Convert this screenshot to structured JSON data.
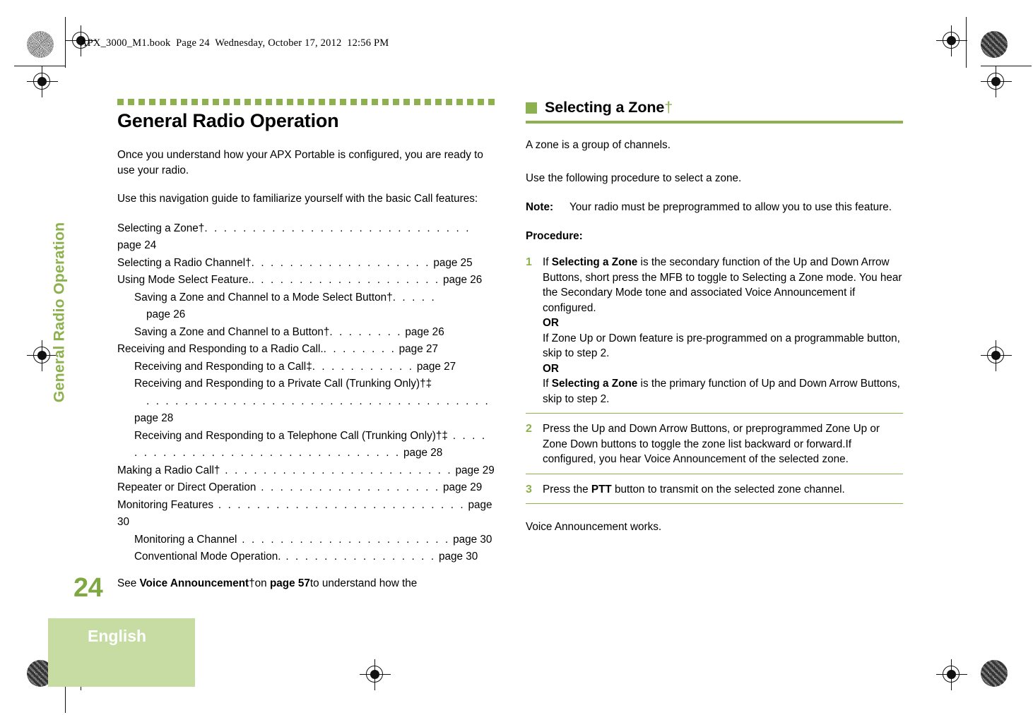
{
  "doc": {
    "header": "APX_3000_M1.book  Page 24  Wednesday, October 17, 2012  12:56 PM",
    "chapter_tab": "General Radio Operation",
    "page_number": "24",
    "language_tab": "English",
    "accent_color": "#8DB14E",
    "tab_color": "#C6DCA2"
  },
  "left_column": {
    "title": "General Radio Operation",
    "intro_1": "Once you understand how your APX Portable is configured, you are ready to use your radio.",
    "intro_2": "Use this navigation guide to familiarize yourself with the basic Call features:",
    "toc": [
      {
        "label": "Selecting a Zone†",
        "leader": ". . . . . . . . . . . . . . . . . . . . . . . . . . . .",
        "page": "page 24",
        "indent": 0
      },
      {
        "label": "Selecting a Radio Channel†",
        "leader": ". . . . . . . . . . . . . . . . . . .",
        "page": "page 25",
        "indent": 0
      },
      {
        "label": "Using Mode Select Feature.",
        "leader": ". . . . . . . . . . . . . . . . . . . .",
        "page": "page 26",
        "indent": 0
      },
      {
        "label": "Saving a Zone and Channel to a Mode Select Button†",
        "leader": ". . . . .",
        "page": "page 26",
        "indent": 1,
        "page_on_new_line": true
      },
      {
        "label": "Saving a Zone and Channel to a Button†",
        "leader": ". . . . . . . .",
        "page": "page 26",
        "indent": 1
      },
      {
        "label": "Receiving and Responding to a Radio Call.",
        "leader": ". . . . . . . .",
        "page": "page 27",
        "indent": 0
      },
      {
        "label": "Receiving and Responding to a Call‡",
        "leader": ". . . . . . . . . . .",
        "page": "page 27",
        "indent": 1
      },
      {
        "label": "Receiving and Responding to a Private Call (Trunking Only)†‡",
        "leader": ". . . . . . . . . . . . . . . . . . . . . . . . . . . . . . . . . . . .",
        "page": "page 28",
        "indent": 1,
        "leader_on_new_line": true
      },
      {
        "label": "Receiving and Responding to a Telephone Call (Trunking Only)†‡",
        "leader": " . . . . . . . . . . . . . . . . . . . . . . . . . . . . . . . .",
        "page": "page 28",
        "indent": 1
      },
      {
        "label": "Making a Radio Call†",
        "leader": " . . . . . . . . . . . . . . . . . . . . . . . .",
        "page": "page 29",
        "indent": 0
      },
      {
        "label": "Repeater or Direct Operation",
        "leader": " . . . . . . . . . . . . . . . . . . .",
        "page": "page 29",
        "indent": 0
      },
      {
        "label": "Monitoring Features",
        "leader": " . . . . . . . . . . . . . . . . . . . . . . . . . .",
        "page": "page 30",
        "indent": 0
      },
      {
        "label": "Monitoring a Channel",
        "leader": " . . . . . . . . . . . . . . . . . . . . . .",
        "page": "page 30",
        "indent": 1
      },
      {
        "label": "Conventional Mode Operation.",
        "leader": " . . . . . . . . . . . . . . . .",
        "page": "page 30",
        "indent": 1
      }
    ],
    "closing_note": {
      "prefix": "See ",
      "bold_1": "Voice Announcement",
      "dagger": "†",
      "mid": "on ",
      "bold_2": "page 57",
      "suffix": "to understand how the"
    }
  },
  "right_column": {
    "section_title": "Selecting a Zone",
    "section_title_dagger": "†",
    "intro_1": "A zone is a group of channels.",
    "intro_2": "Use the following procedure to select a zone.",
    "note": {
      "label": "Note:",
      "text": "Your radio must be preprogrammed to allow you to use this feature."
    },
    "procedure_label": "Procedure:",
    "steps": [
      {
        "num": "1",
        "parts": [
          {
            "t": "If ",
            "b": false
          },
          {
            "t": "Selecting a Zone",
            "b": true
          },
          {
            "t": " is the secondary function of the Up and Down Arrow Buttons, short press the MFB to toggle to Selecting a Zone mode. You hear the Secondary Mode tone and associated Voice Announcement if configured.",
            "b": false
          },
          {
            "t": "\n",
            "br": true
          },
          {
            "t": "OR",
            "b": true
          },
          {
            "t": "\n",
            "br": true
          },
          {
            "t": "If Zone Up or Down feature is pre-programmed on a programmable button, skip to step 2.",
            "b": false
          },
          {
            "t": "\n",
            "br": true
          },
          {
            "t": "OR",
            "b": true
          },
          {
            "t": "\n",
            "br": true
          },
          {
            "t": "If ",
            "b": false
          },
          {
            "t": "Selecting a Zone",
            "b": true
          },
          {
            "t": " is the primary function of Up and Down Arrow Buttons, skip to step 2.",
            "b": false
          }
        ]
      },
      {
        "num": "2",
        "parts": [
          {
            "t": "Press the Up and Down Arrow Buttons, or preprogrammed Zone Up or Zone Down buttons to toggle the zone list backward or forward.If configured, you hear Voice Announcement of the selected zone.",
            "b": false
          }
        ]
      },
      {
        "num": "3",
        "parts": [
          {
            "t": "Press the ",
            "b": false
          },
          {
            "t": "PTT",
            "b": true
          },
          {
            "t": " button to transmit on the selected zone channel.",
            "b": false
          }
        ]
      }
    ],
    "tail": "Voice Announcement works."
  }
}
